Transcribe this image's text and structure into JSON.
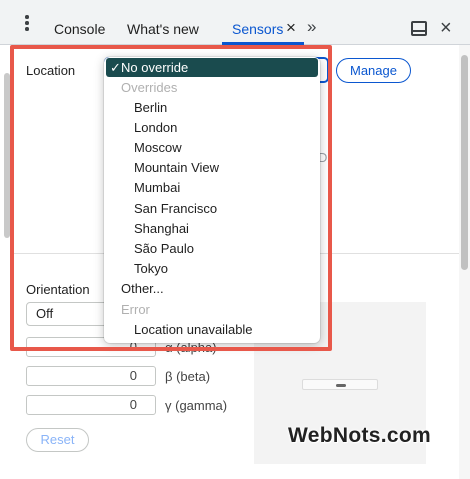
{
  "tabbar": {
    "tabs": [
      {
        "label": "Console"
      },
      {
        "label": "What's new"
      },
      {
        "label": "Sensors",
        "active": true
      }
    ],
    "close_tab_glyph": "×",
    "more_tabs_glyph": "»",
    "panel_close_glyph": "×"
  },
  "location": {
    "label": "Location",
    "selected_value": "No override",
    "manage_label": "Manage",
    "partial_text": "D"
  },
  "dropdown": {
    "check_glyph": "✓",
    "selected": "No override",
    "groups": [
      {
        "label": "Overrides",
        "items": [
          "Berlin",
          "London",
          "Moscow",
          "Mountain View",
          "Mumbai",
          "San Francisco",
          "Shanghai",
          "São Paulo",
          "Tokyo"
        ]
      }
    ],
    "other_label": "Other...",
    "error_group": {
      "label": "Error",
      "items": [
        "Location unavailable"
      ]
    }
  },
  "orientation": {
    "label": "Orientation",
    "selected_value": "Off",
    "alpha": {
      "value": "0",
      "label": "α (alpha)"
    },
    "beta": {
      "value": "0",
      "label": "β (beta)"
    },
    "gamma": {
      "value": "0",
      "label": "γ (gamma)"
    },
    "reset_label": "Reset"
  },
  "watermark": "WebNots.com",
  "colors": {
    "accent": "#0b57d0",
    "highlight": "#e8584a",
    "selected_option_bg": "#1a4b4e"
  }
}
